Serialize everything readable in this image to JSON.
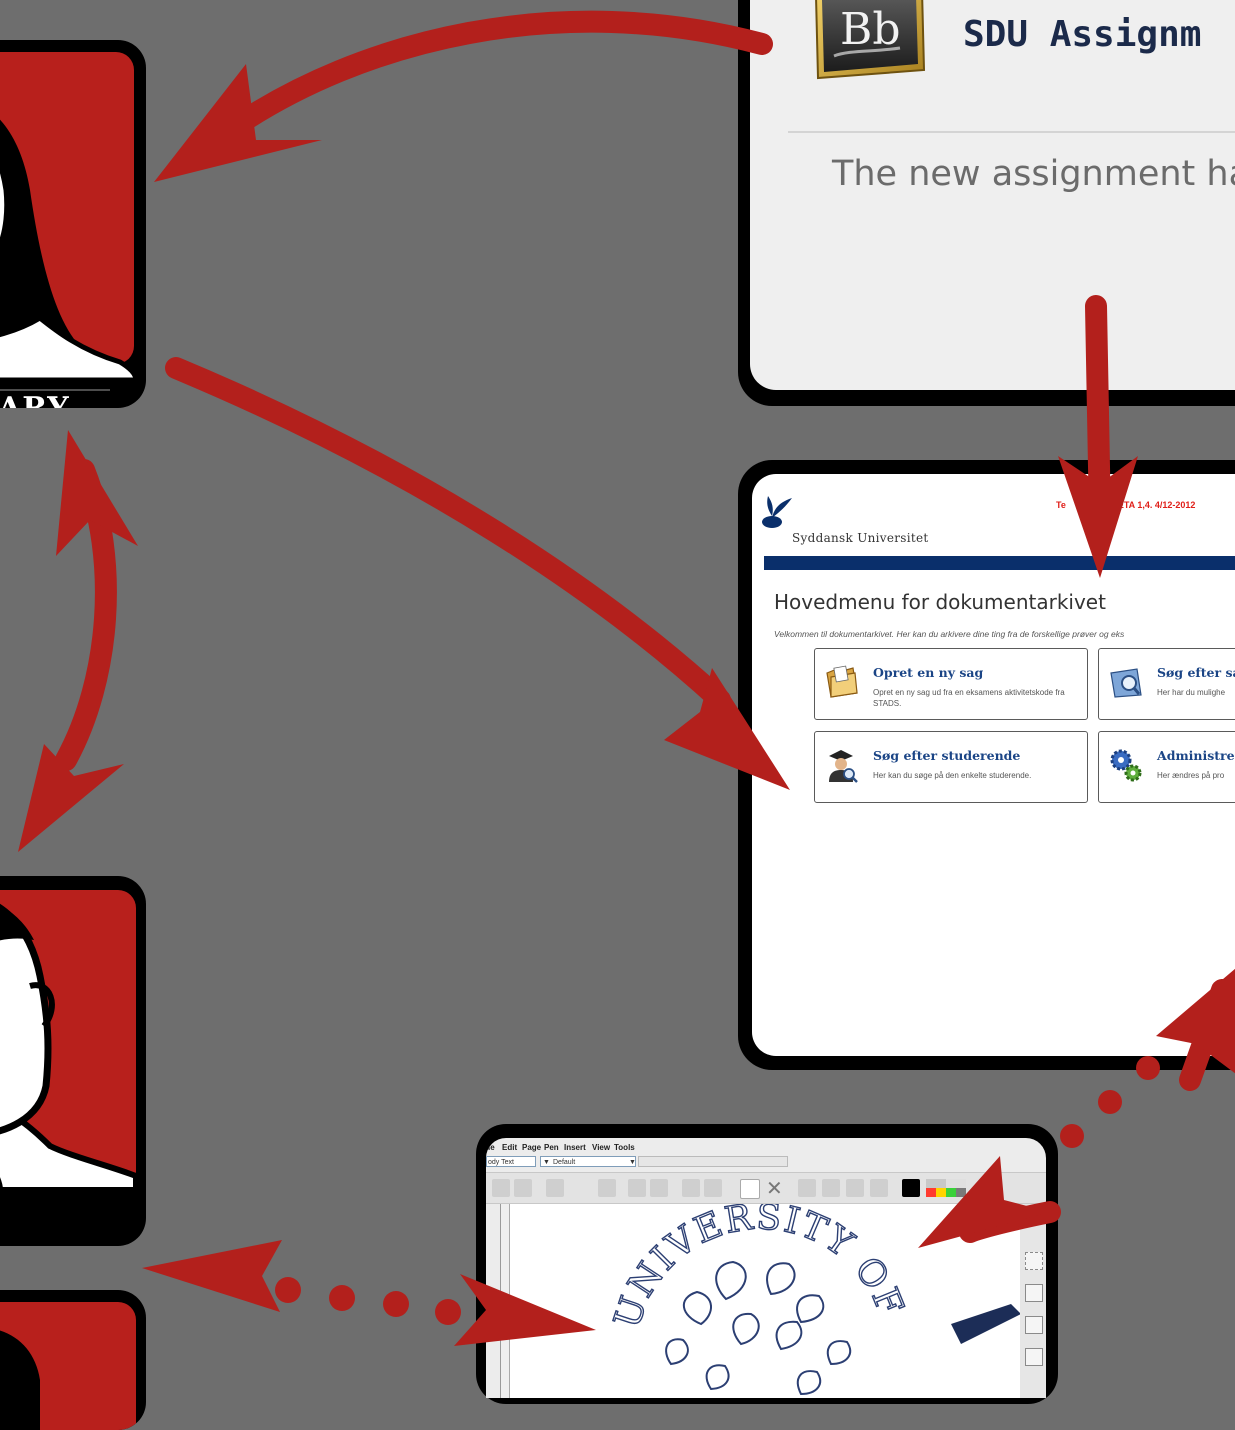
{
  "roles": {
    "library_label": "ARY"
  },
  "blackboard": {
    "logo_text": "Bb",
    "title": "SDU Assignm",
    "message": "The new assignment ha"
  },
  "archive": {
    "university_name": "Syddansk Universitet",
    "version_text": "ETA 1,4.  4/12-2012",
    "version_prefix": "Te",
    "heading": "Hovedmenu for dokumentarkivet",
    "intro": "Velkommen til dokumentarkivet. Her kan du arkivere dine ting fra de forskellige prøver og eks",
    "tiles": [
      {
        "title": "Opret en ny sag",
        "description": "Opret en ny sag ud fra en eksamens aktivitetskode fra STADS."
      },
      {
        "title": "Søg efter sag",
        "description": "Her har du mulighe"
      },
      {
        "title": "Søg efter studerende",
        "description": "Her kan du søge på den enkelte studerende."
      },
      {
        "title": "Administrer",
        "description": "Her ændres på pro"
      }
    ]
  },
  "sketch": {
    "menu": [
      "le",
      "Edit",
      "Page",
      "Pen",
      "Insert",
      "View",
      "Tools"
    ],
    "style_select": "ody Text",
    "font_select": "Default",
    "seal_text": "UNIVERSITY OF"
  },
  "colors": {
    "background": "#6e6e6e",
    "arrow_red": "#b3201c",
    "card_red": "#b8201c",
    "sdu_blue": "#0a2f6b"
  }
}
